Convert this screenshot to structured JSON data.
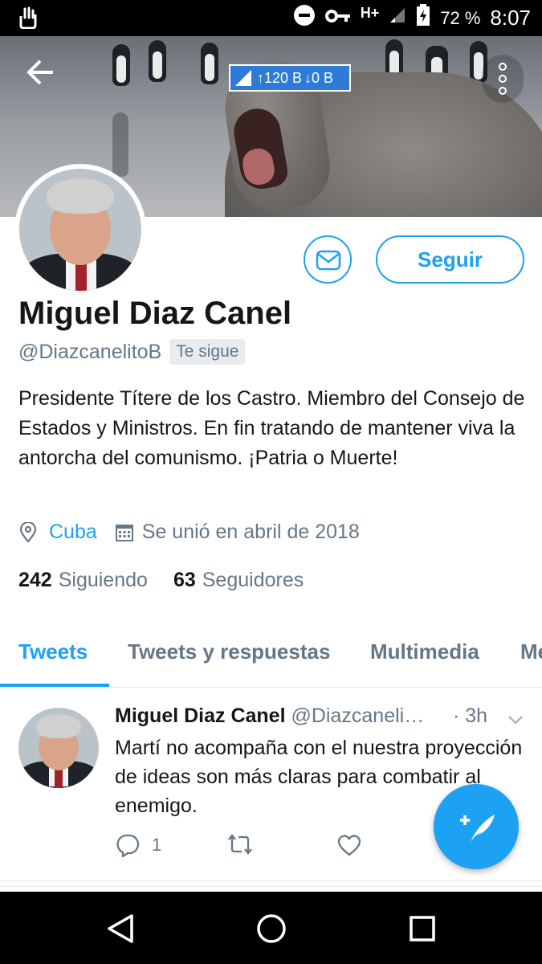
{
  "status_bar": {
    "network": "H+",
    "battery": "72 %",
    "time": "8:07"
  },
  "speed_badge": {
    "upload": "↑120 B",
    "download": "↓0 B"
  },
  "profile": {
    "name": "Miguel Diaz Canel",
    "handle": "@DiazcanelitoB",
    "follows_you": "Te sigue",
    "bio": "Presidente Títere de los Castro. Miembro del Consejo de Estados y Ministros. En fin tratando de mantener viva la antorcha del comunismo. ¡Patria o Muerte!",
    "location": "Cuba",
    "joined": "Se unió en abril de 2018",
    "following_count": "242",
    "following_label": "Siguiendo",
    "followers_count": "63",
    "followers_label": "Seguidores",
    "follow_button": "Seguir"
  },
  "tabs": [
    {
      "label": "Tweets",
      "active": true
    },
    {
      "label": "Tweets y respuestas",
      "active": false
    },
    {
      "label": "Multimedia",
      "active": false
    },
    {
      "label": "Me",
      "active": false
    }
  ],
  "tweet": {
    "name": "Miguel Diaz Canel",
    "handle": "@Diazcaneli…",
    "time": "· 3h",
    "text": "Martí no acompaña con el nuestra proyección de ideas son más claras para combatir al enemigo.",
    "reply_count": "1"
  },
  "colors": {
    "accent": "#1da1f2",
    "secondary_text": "#657786",
    "primary_text": "#14171a"
  },
  "icons": [
    "back-arrow-icon",
    "more-vertical-icon",
    "mail-icon",
    "location-pin-icon",
    "calendar-icon",
    "reply-icon",
    "retweet-icon",
    "like-icon",
    "compose-tweet-icon"
  ]
}
